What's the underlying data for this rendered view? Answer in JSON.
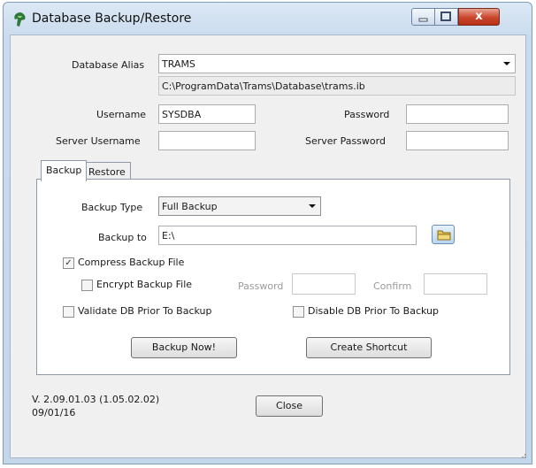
{
  "window": {
    "title": "Database Backup/Restore",
    "close_glyph": "x"
  },
  "connection": {
    "alias_label": "Database Alias",
    "alias_value": "TRAMS",
    "path": "C:\\ProgramData\\Trams\\Database\\trams.ib",
    "username_label": "Username",
    "username_value": "SYSDBA",
    "password_label": "Password",
    "password_value": "",
    "server_username_label": "Server Username",
    "server_username_value": "",
    "server_password_label": "Server Password",
    "server_password_value": ""
  },
  "tabs": [
    {
      "label": "Backup",
      "active": true
    },
    {
      "label": "Restore",
      "active": false
    }
  ],
  "backup": {
    "type_label": "Backup Type",
    "type_value": "Full Backup",
    "to_label": "Backup to",
    "to_value": "E:\\",
    "compress_label": "Compress Backup File",
    "compress_checked": true,
    "encrypt_label": "Encrypt Backup File",
    "encrypt_checked": false,
    "enc_password_label": "Password",
    "enc_confirm_label": "Confirm",
    "validate_label": "Validate DB Prior To Backup",
    "validate_checked": false,
    "disable_label": "Disable DB Prior To Backup",
    "disable_checked": false,
    "backup_now_label": "Backup Now!",
    "create_shortcut_label": "Create Shortcut"
  },
  "footer": {
    "version": "V. 2.09.01.03 (1.05.02.02)",
    "date": "09/01/16",
    "close_label": "Close"
  },
  "icons": [
    "app-icon",
    "minimize-icon",
    "maximize-icon",
    "close-icon",
    "dropdown-arrow-icon",
    "folder-icon",
    "checkmark-icon"
  ]
}
